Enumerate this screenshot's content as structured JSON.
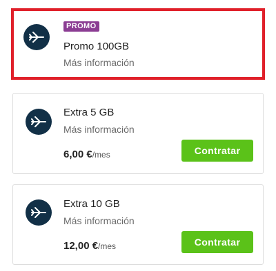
{
  "colors": {
    "highlight_border": "#e0202a",
    "icon_bg": "#123047",
    "promo_badge": "#8b3d93",
    "button_bg": "#5bc219"
  },
  "cards": [
    {
      "badge": "PROMO",
      "icon": "plane-icon",
      "title": "Promo 100GB",
      "more_info": "Más información"
    },
    {
      "icon": "plane-icon",
      "title": "Extra 5 GB",
      "more_info": "Más información",
      "price": "6,00 €",
      "per": "/mes",
      "button": "Contratar"
    },
    {
      "icon": "plane-icon",
      "title": "Extra 10 GB",
      "more_info": "Más información",
      "price": "12,00 €",
      "per": "/mes",
      "button": "Contratar"
    }
  ]
}
